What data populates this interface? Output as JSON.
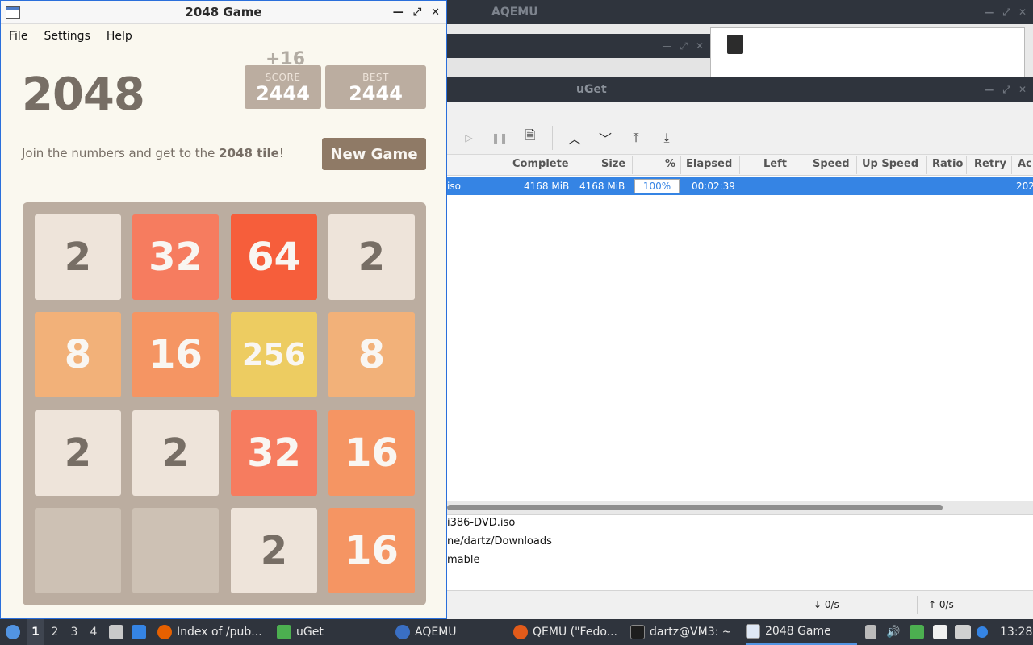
{
  "aqemu": {
    "title": "AQEMU"
  },
  "uget": {
    "title": "uGet",
    "columns": [
      "Complete",
      "Size",
      "%",
      "Elapsed",
      "Left",
      "Speed",
      "Up Speed",
      "Ratio",
      "Retry",
      "Ac"
    ],
    "row": {
      "name": "iso",
      "complete": "4168 MiB",
      "size": "4168 MiB",
      "percent": "100%",
      "elapsed": "00:02:39",
      "added": "202"
    },
    "details": [
      "i386-DVD.iso",
      "ne/dartz/Downloads",
      "mable"
    ],
    "status": {
      "down": "↓ 0/s",
      "up": "↑ 0/s"
    }
  },
  "game": {
    "window_title": "2048 Game",
    "menu": [
      "File",
      "Settings",
      "Help"
    ],
    "logo": "2048",
    "score_delta": "+16",
    "score_label": "SCORE",
    "score": "2444",
    "best_label": "BEST",
    "best": "2444",
    "intro_prefix": "Join the numbers and get to the ",
    "intro_bold": "2048 tile",
    "intro_suffix": "!",
    "new_game": "New Game",
    "grid": [
      [
        "2",
        "32",
        "64",
        "2"
      ],
      [
        "8",
        "16",
        "256",
        "8"
      ],
      [
        "2",
        "2",
        "32",
        "16"
      ],
      [
        "",
        "",
        "2",
        "16"
      ]
    ],
    "colors": {
      "empty": "#cdc1b4",
      "2": "#eee4da",
      "8": "#f2b179",
      "16": "#f59563",
      "32": "#f67c5f",
      "64": "#f65e3b",
      "256": "#edcc61"
    }
  },
  "taskbar": {
    "workspaces": [
      "1",
      "2",
      "3",
      "4"
    ],
    "tasks": [
      "Index of /pub...",
      "uGet",
      "AQEMU",
      "QEMU (\"Fedo...",
      "dartz@VM3: ~",
      "2048 Game"
    ],
    "clock": "13:28"
  }
}
